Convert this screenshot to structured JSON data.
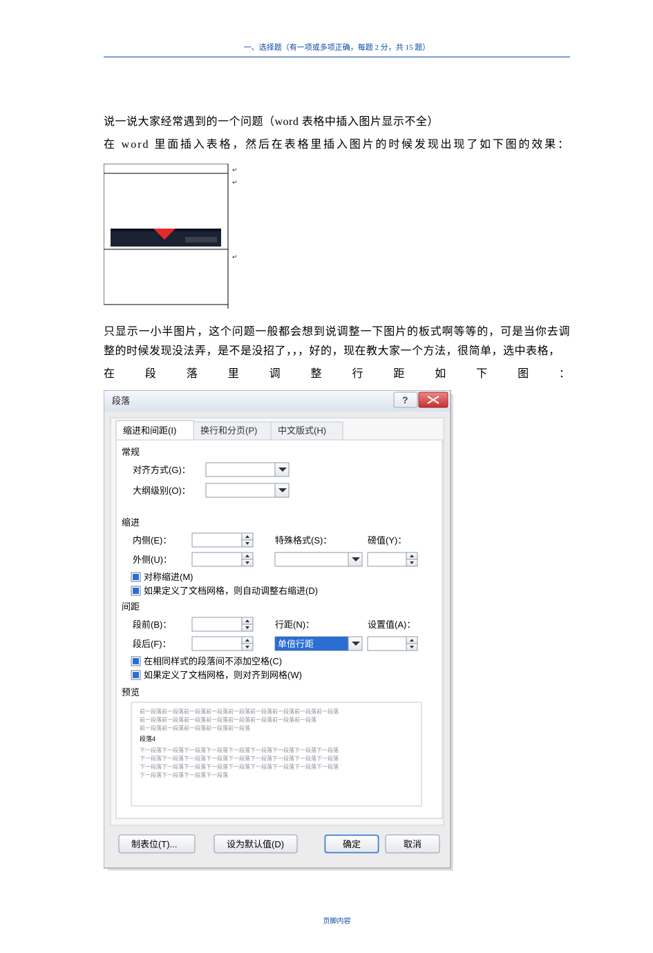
{
  "header": "一、选择题（有一项或多项正确，每题 2 分，共 15 题）",
  "footer": "页脚内容",
  "p1": "说一说大家经常遇到的一个问题（word 表格中插入图片显示不全）",
  "p2": "在 word 里面插入表格，然后在表格里插入图片的时候发现出现了如下图的效果：",
  "p3": "只显示一小半图片，这个问题一般都会想到说调整一下图片的板式啊等等的，可是当你去调整的时候发现没法弄，是不是没招了，，，好的，现在教大家一个方法，很简单，选中表格，",
  "p4": "在段落里调整行距如下图：",
  "dialog": {
    "title": "段落",
    "tabs": [
      "缩进和间距(I)",
      "换行和分页(P)",
      "中文版式(H)"
    ],
    "section_general": "常规",
    "align_label": "对齐方式(G)：",
    "outline_label": "大纲级别(O)：",
    "section_indent": "缩进",
    "inside_label": "内侧(E)：",
    "outside_label": "外侧(U)：",
    "special_label": "特殊格式(S)：",
    "special_value_label": "磅值(Y)：",
    "mirror_check": "对称缩进(M)",
    "grid_indent_check": "如果定义了文档网格，则自动调整右缩进(D)",
    "section_spacing": "间距",
    "before_label": "段前(B)：",
    "after_label": "段后(F)：",
    "linespacing_label": "行距(N)：",
    "linespacing_value": "单倍行距",
    "setat_label": "设置值(A)：",
    "nospace_check": "在相同样式的段落间不添加空格(C)",
    "snapgrid_check": "如果定义了文档网格，则对齐到网格(W)",
    "preview_label": "预览",
    "preview_line_prev": "前一段落前一段落前一段落前一段落前一段落前一段落前一段落前一段落前一段落",
    "preview_line_prev2": "前一段落前一段落前一段落前一段落前一段落前一段落前一段落前一段落",
    "preview_line_prev3": "前一段落前一段落前一段落前一段落前一段落",
    "preview_sample": "段落4",
    "preview_line_next": "下一段落下一段落下一段落下一段落下一段落下一段落下一段落下一段落下一段落",
    "preview_line_next2": "下一段落下一段落下一段落下一段落下一段落下一段落下一段落下一段落下一段落",
    "preview_line_next3": "下一段落下一段落下一段落下一段落下一段落下一段落下一段落下一段落下一段落",
    "preview_line_next4": "下一段落下一段落下一段落下一段落",
    "tabs_btn": "制表位(T)...",
    "default_btn": "设为默认值(D)",
    "ok_btn": "确定",
    "cancel_btn": "取消"
  }
}
